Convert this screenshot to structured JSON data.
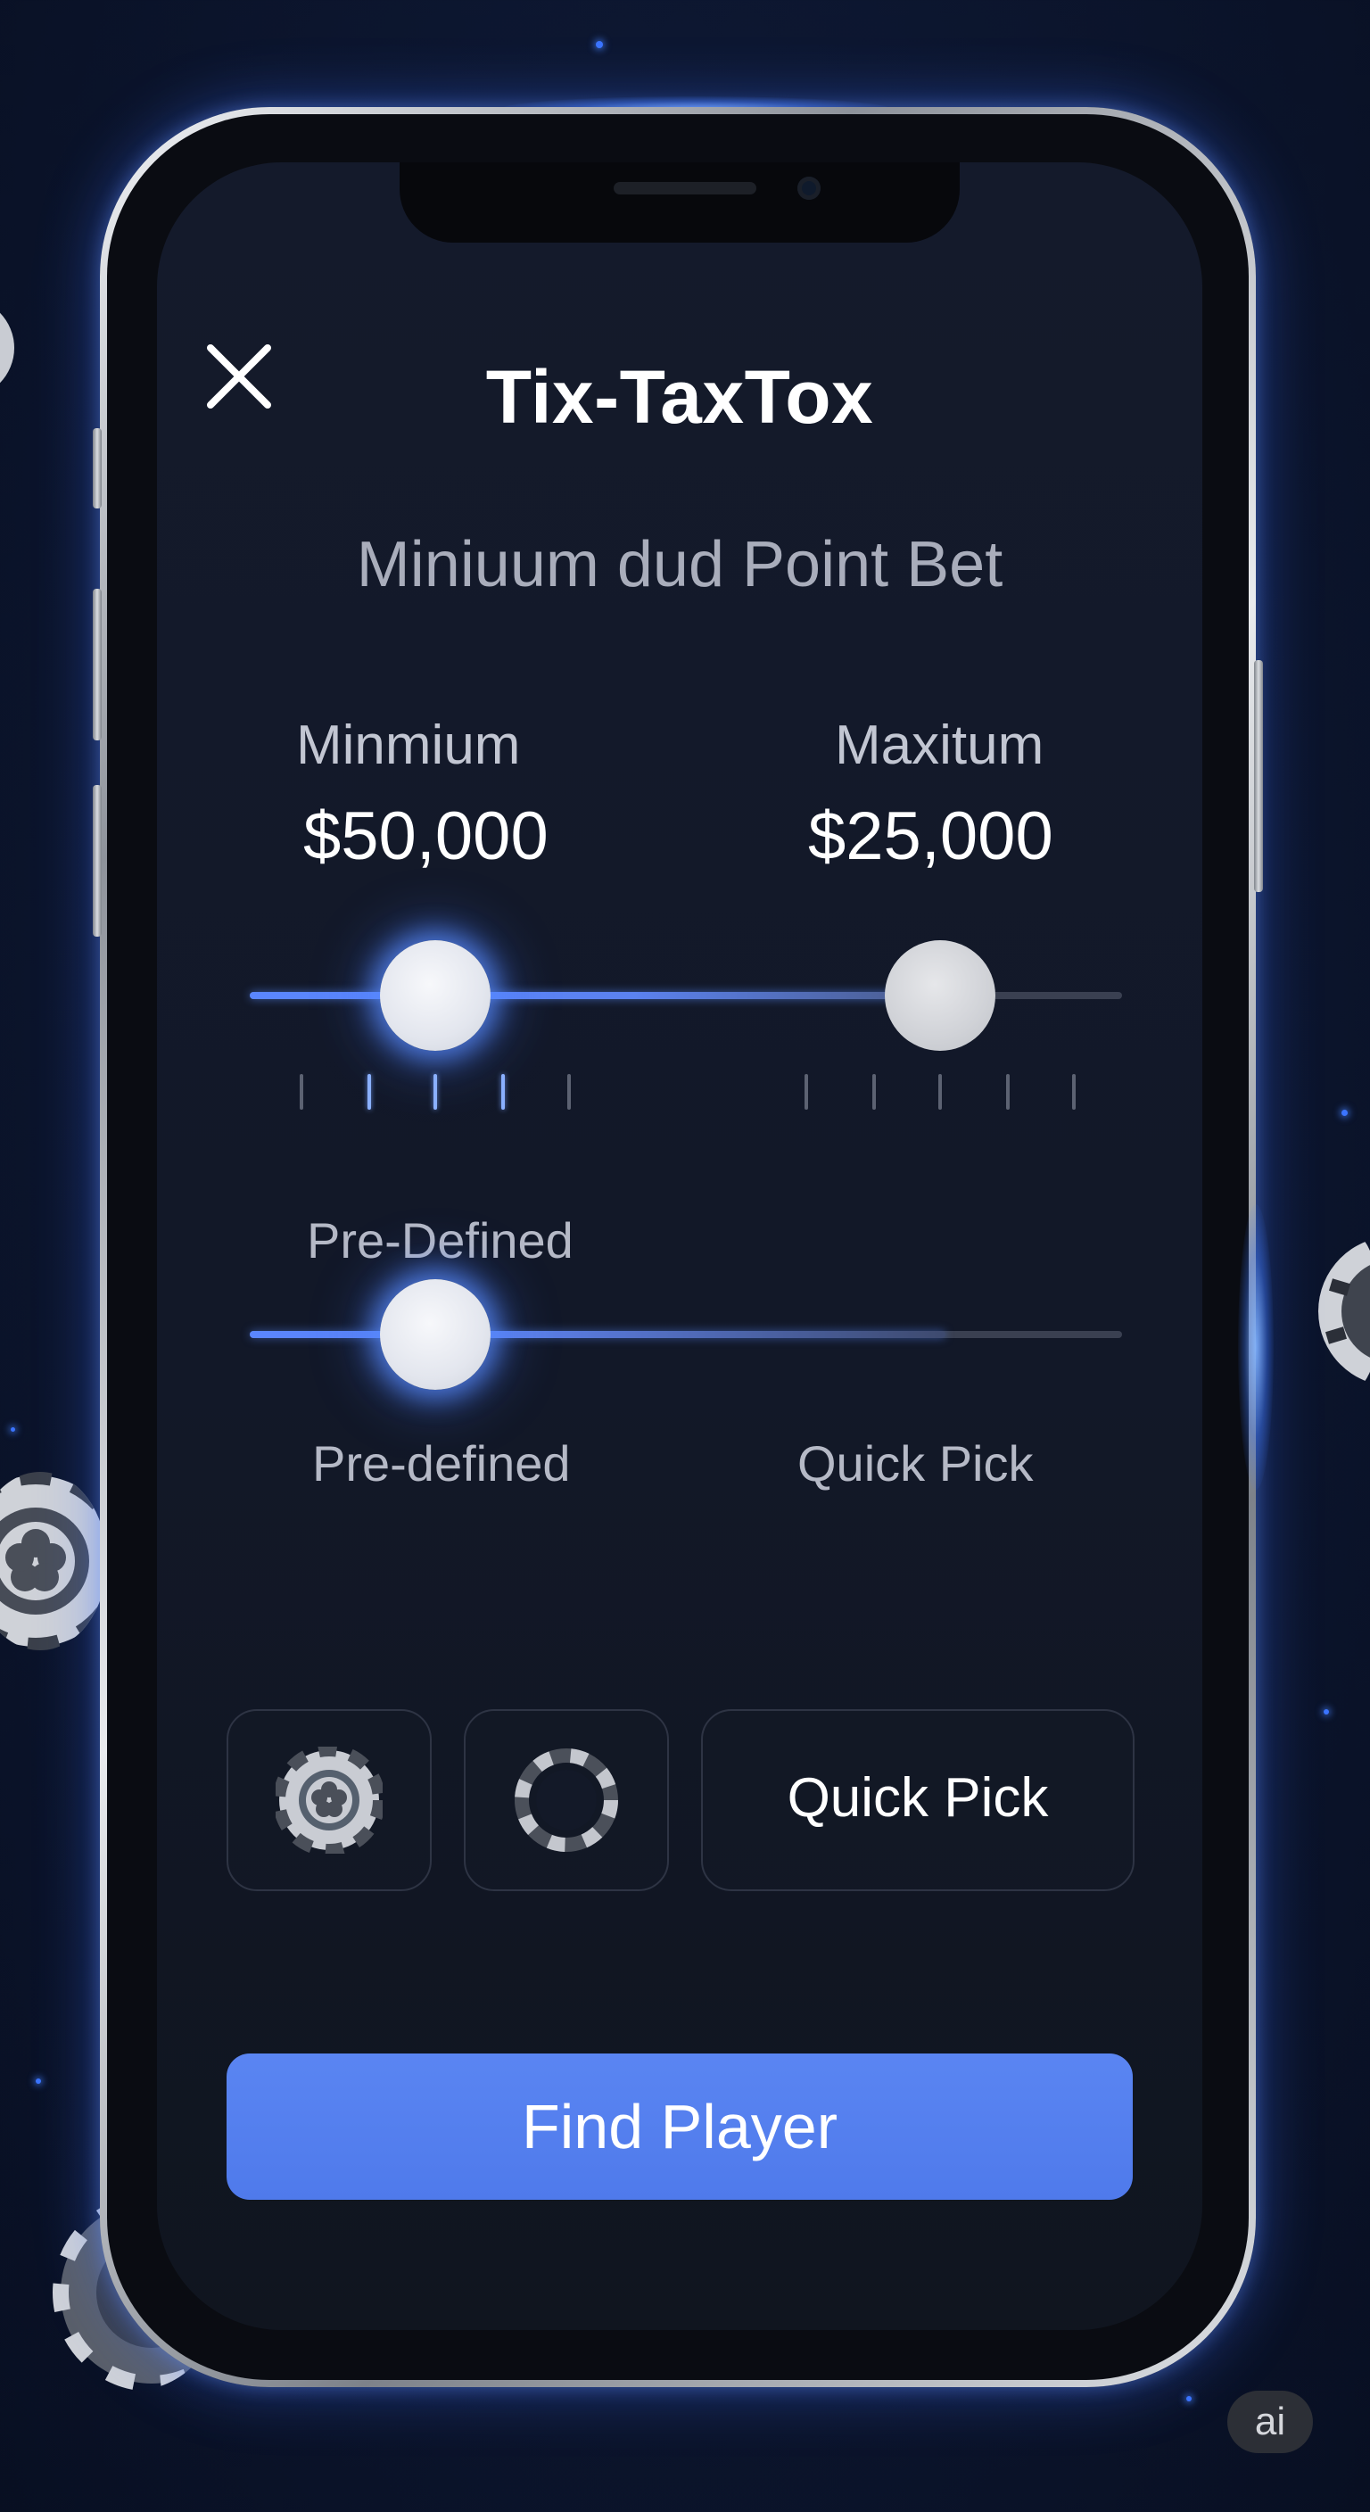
{
  "app": {
    "title": "Tix-TaxTox",
    "subtitle": "Miniuum dud Point Bet"
  },
  "bet_range": {
    "min_label": "Minmium",
    "min_value": "$50,000",
    "max_label": "Maxitum",
    "max_value": "$25,000"
  },
  "mode": {
    "label": "Pre-Defined",
    "left_option": "Pre-defined",
    "right_option": "Quick Pick"
  },
  "options": {
    "chip_icon": "poker-chip-icon",
    "ring_icon": "chip-ring-icon",
    "quick_pick_label": "Quick Pick"
  },
  "actions": {
    "find_player_label": "Find Player",
    "close_icon": "close-icon"
  },
  "watermark": {
    "label": "ai"
  },
  "colors": {
    "accent": "#4f7aeb",
    "slider_glow": "#5a8cff",
    "screen_bg": "#131929",
    "page_bg": "#0b1329"
  }
}
